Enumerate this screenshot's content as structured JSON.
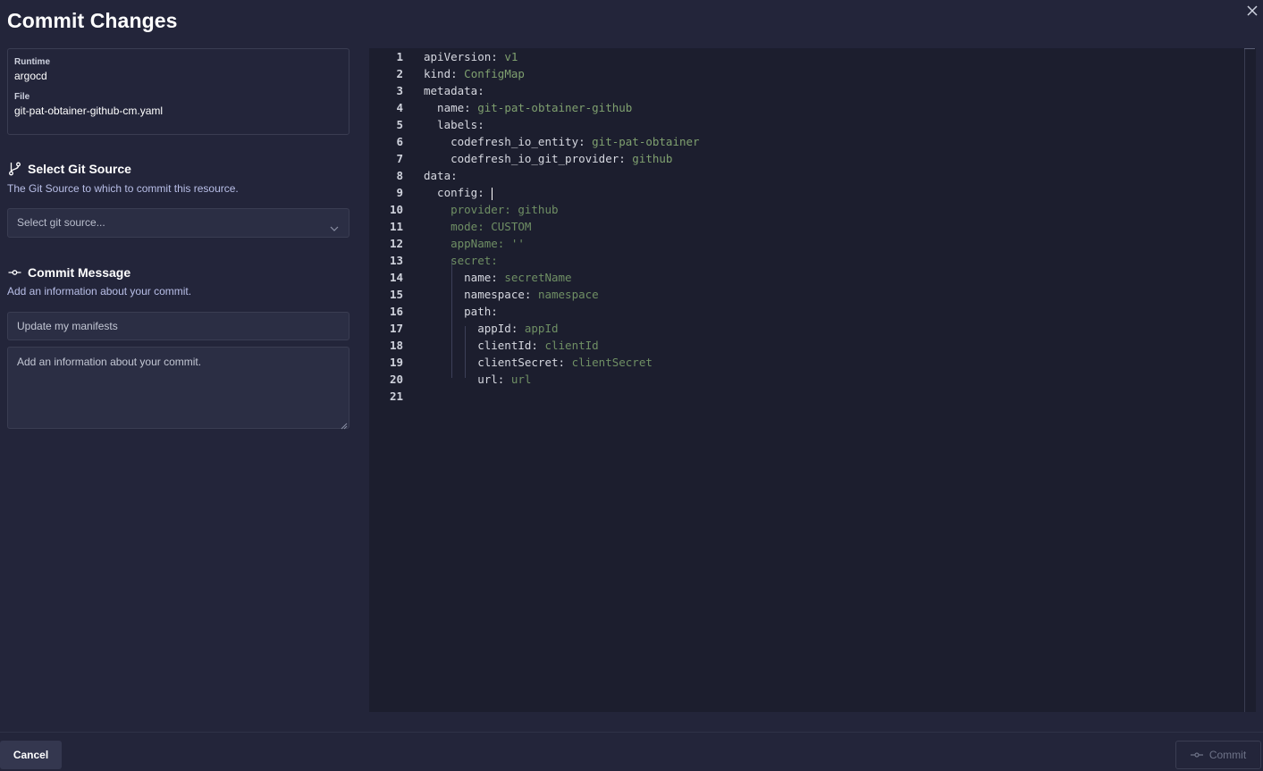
{
  "dialog": {
    "title": "Commit Changes",
    "close_icon": "close-icon"
  },
  "info": {
    "runtime_label": "Runtime",
    "runtime_value": "argocd",
    "file_label": "File",
    "file_value": "git-pat-obtainer-github-cm.yaml"
  },
  "git_source": {
    "heading": "Select Git Source",
    "icon": "git-branch-icon",
    "description": "The Git Source to which to commit this resource.",
    "select_placeholder": "Select git source..."
  },
  "commit_message": {
    "heading": "Commit Message",
    "icon": "commit-icon",
    "description": "Add an information about your commit.",
    "summary_placeholder": "Update my manifests",
    "details_placeholder": "Add an information about your commit."
  },
  "editor": {
    "lines": [
      {
        "n": "1",
        "indent": 0,
        "key": "apiVersion:",
        "val": " v1",
        "vclass": "v"
      },
      {
        "n": "2",
        "indent": 0,
        "key": "kind:",
        "val": " ConfigMap",
        "vclass": "v"
      },
      {
        "n": "3",
        "indent": 0,
        "key": "metadata:",
        "val": "",
        "vclass": "v"
      },
      {
        "n": "4",
        "indent": 2,
        "key": "name:",
        "val": " git-pat-obtainer-github",
        "vclass": "v"
      },
      {
        "n": "5",
        "indent": 2,
        "key": "labels:",
        "val": "",
        "vclass": "v"
      },
      {
        "n": "6",
        "indent": 4,
        "key": "codefresh_io_entity:",
        "val": " git-pat-obtainer",
        "vclass": "v"
      },
      {
        "n": "7",
        "indent": 4,
        "key": "codefresh_io_git_provider:",
        "val": " github",
        "vclass": "v"
      },
      {
        "n": "8",
        "indent": 0,
        "key": "data:",
        "val": "",
        "vclass": "v"
      },
      {
        "n": "9",
        "indent": 2,
        "key": "config:",
        "val": " ",
        "vclass": "v",
        "cursor": true
      },
      {
        "n": "10",
        "indent": 4,
        "key": "",
        "val": "provider: github",
        "vclass": "c"
      },
      {
        "n": "11",
        "indent": 4,
        "key": "",
        "val": "mode: CUSTOM",
        "vclass": "c"
      },
      {
        "n": "12",
        "indent": 4,
        "key": "",
        "val": "appName: ''",
        "vclass": "c"
      },
      {
        "n": "13",
        "indent": 4,
        "key": "",
        "val": "secret:",
        "vclass": "c"
      },
      {
        "n": "14",
        "indent": 6,
        "key": "name:",
        "val": " secretName",
        "vclass": "c"
      },
      {
        "n": "15",
        "indent": 6,
        "key": "namespace:",
        "val": " namespace",
        "vclass": "c"
      },
      {
        "n": "16",
        "indent": 6,
        "key": "path:",
        "val": "",
        "vclass": "c"
      },
      {
        "n": "17",
        "indent": 8,
        "key": "appId:",
        "val": " appId",
        "vclass": "c"
      },
      {
        "n": "18",
        "indent": 8,
        "key": "clientId:",
        "val": " clientId",
        "vclass": "c"
      },
      {
        "n": "19",
        "indent": 8,
        "key": "clientSecret:",
        "val": " clientSecret",
        "vclass": "c"
      },
      {
        "n": "20",
        "indent": 8,
        "key": "url:",
        "val": " url",
        "vclass": "c"
      },
      {
        "n": "21",
        "indent": 0,
        "key": "",
        "val": "",
        "vclass": "v"
      }
    ]
  },
  "footer": {
    "cancel_label": "Cancel",
    "commit_label": "Commit",
    "commit_icon": "commit-icon"
  }
}
